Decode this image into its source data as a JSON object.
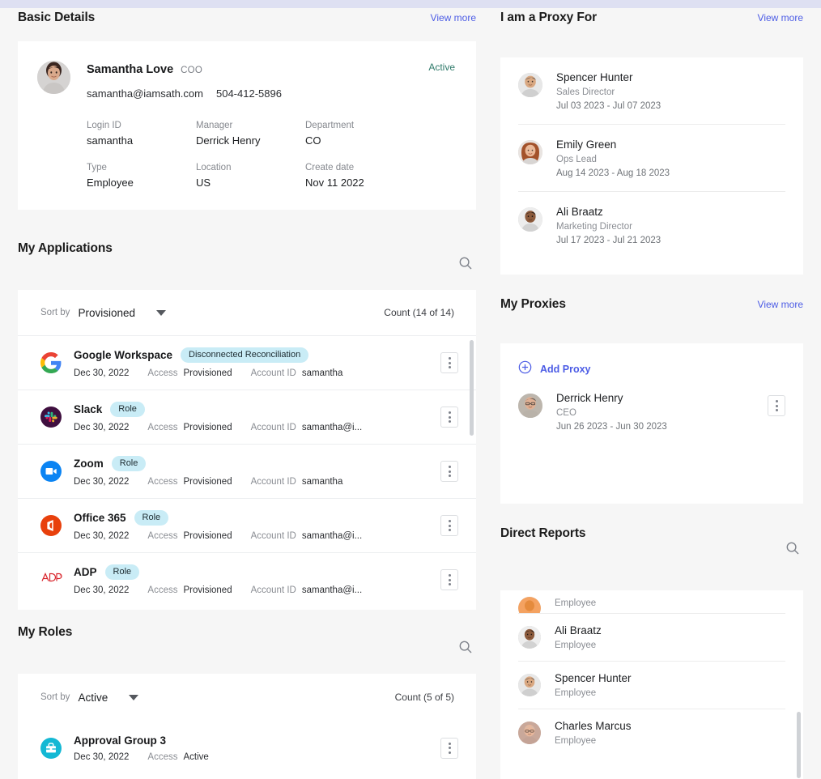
{
  "basic_details": {
    "section_title": "Basic Details",
    "view_more": "View more",
    "name": "Samantha Love",
    "job_title": "COO",
    "email": "samantha@iamsath.com",
    "phone": "504-412-5896",
    "status": "Active",
    "fields": [
      {
        "label": "Login ID",
        "value": "samantha"
      },
      {
        "label": "Manager",
        "value": "Derrick Henry"
      },
      {
        "label": "Department",
        "value": "CO"
      },
      {
        "label": "Type",
        "value": "Employee"
      },
      {
        "label": "Location",
        "value": "US"
      },
      {
        "label": "Create date",
        "value": "Nov 11 2022"
      }
    ]
  },
  "my_applications": {
    "section_title": "My Applications",
    "search_icon": "search-icon",
    "sort_label": "Sort by",
    "sort_value": "Provisioned",
    "count": "Count (14 of 14)",
    "access_key": "Access",
    "account_key": "Account ID",
    "rows": [
      {
        "icon": "google-icon",
        "name": "Google Workspace",
        "chip": "Disconnected Reconciliation",
        "date": "Dec 30, 2022",
        "access": "Provisioned",
        "account": "samantha"
      },
      {
        "icon": "slack-icon",
        "name": "Slack",
        "chip": "Role",
        "date": "Dec 30, 2022",
        "access": "Provisioned",
        "account": "samantha@i..."
      },
      {
        "icon": "zoom-icon",
        "name": "Zoom",
        "chip": "Role",
        "date": "Dec 30, 2022",
        "access": "Provisioned",
        "account": "samantha"
      },
      {
        "icon": "office365-icon",
        "name": "Office 365",
        "chip": "Role",
        "date": "Dec 30, 2022",
        "access": "Provisioned",
        "account": "samantha@i..."
      },
      {
        "icon": "adp-icon",
        "name": "ADP",
        "chip": "Role",
        "date": "Dec 30, 2022",
        "access": "Provisioned",
        "account": "samantha@i..."
      }
    ]
  },
  "my_roles": {
    "section_title": "My Roles",
    "search_icon": "search-icon",
    "sort_label": "Sort by",
    "sort_value": "Active",
    "count": "Count (5 of 5)",
    "access_key": "Access",
    "rows": [
      {
        "icon": "role-briefcase-icon",
        "name": "Approval Group 3",
        "date": "Dec 30, 2022",
        "access": "Active"
      }
    ]
  },
  "i_am_proxy_for": {
    "section_title": "I am a Proxy For",
    "view_more": "View more",
    "rows": [
      {
        "name": "Spencer Hunter",
        "title": "Sales Director",
        "dates": "Jul 03 2023 - Jul 07 2023"
      },
      {
        "name": "Emily Green",
        "title": "Ops Lead",
        "dates": "Aug 14 2023 - Aug 18 2023"
      },
      {
        "name": "Ali Braatz",
        "title": "Marketing Director",
        "dates": "Jul 17 2023 - Jul 21 2023"
      }
    ]
  },
  "my_proxies": {
    "section_title": "My Proxies",
    "view_more": "View more",
    "add_proxy_label": "Add Proxy",
    "add_icon": "plus-circle-icon",
    "rows": [
      {
        "name": "Derrick Henry",
        "title": "CEO",
        "dates": "Jun 26 2023 - Jun 30 2023"
      }
    ]
  },
  "direct_reports": {
    "section_title": "Direct Reports",
    "search_icon": "search-icon",
    "rows": [
      {
        "name": "",
        "title": "Employee",
        "clipped": true
      },
      {
        "name": "Ali Braatz",
        "title": "Employee"
      },
      {
        "name": "Spencer Hunter",
        "title": "Employee"
      },
      {
        "name": "Charles Marcus",
        "title": "Employee"
      }
    ]
  },
  "colors": {
    "accent_link": "#4c5ce5",
    "status_active": "#2f7a6a",
    "chip_bg": "#c9ecf6",
    "page_bg": "#f6f6f6",
    "top_band": "#dee0f2"
  }
}
